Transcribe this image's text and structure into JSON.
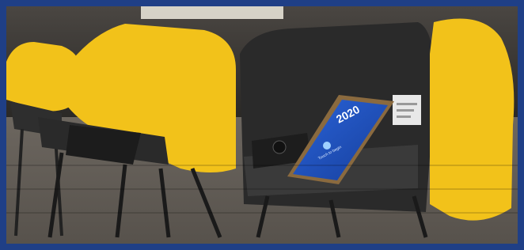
{
  "photo": {
    "description_alt": "Row of voting booths with yellow privacy shields and a ballot-marking tablet",
    "tablet": {
      "year": "2020",
      "bottom_text": "Touch to begin"
    },
    "colors": {
      "frame": "#1f3f86",
      "shield_yellow": "#f2c21a",
      "shield_dark": "#2a2a2a",
      "carpet": "#5f5a55",
      "screen_blue": "#1c4fbf"
    }
  }
}
